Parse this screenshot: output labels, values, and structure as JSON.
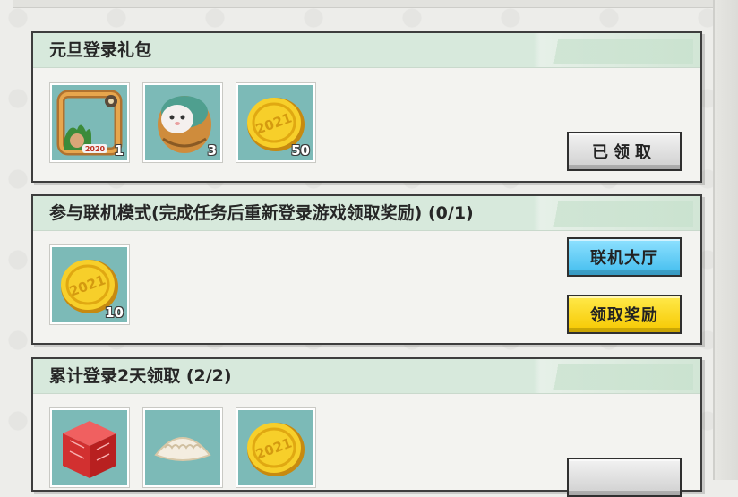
{
  "panels": [
    {
      "title": "元旦登录礼包",
      "items": [
        {
          "icon": "avatar-frame-icon",
          "count": "1"
        },
        {
          "icon": "egg-pet-icon",
          "count": "3"
        },
        {
          "icon": "gold-coin-icon",
          "count": "50"
        }
      ],
      "buttons": [
        {
          "label": "已领取",
          "style": "gray"
        }
      ]
    },
    {
      "title": "参与联机模式(完成任务后重新登录游戏领取奖励) (0/1)",
      "items": [
        {
          "icon": "gold-coin-icon",
          "count": "10"
        }
      ],
      "buttons": [
        {
          "label": "联机大厅",
          "style": "blue"
        },
        {
          "label": "领取奖励",
          "style": "yellow"
        }
      ]
    },
    {
      "title": "累计登录2天领取 (2/2)",
      "items": [
        {
          "icon": "red-block-icon",
          "count": ""
        },
        {
          "icon": "dumpling-icon",
          "count": ""
        },
        {
          "icon": "gold-coin-icon",
          "count": ""
        }
      ],
      "buttons": []
    }
  ],
  "coin_text": "2021",
  "frame_text": "2020",
  "colors": {
    "item_bg": "#7cbab7",
    "header_bg": "#d7e9dc",
    "btn_blue": "#42bdee",
    "btn_yellow": "#f6c800",
    "btn_gray": "#cfcfcf"
  }
}
